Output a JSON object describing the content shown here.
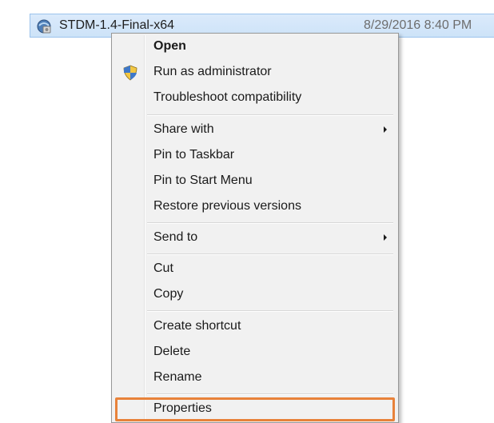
{
  "file": {
    "name": "STDM-1.4-Final-x64",
    "date": "8/29/2016 8:40 PM",
    "icon": "setup-installer-icon"
  },
  "menu": {
    "groups": [
      [
        {
          "label": "Open",
          "bold": true
        },
        {
          "label": "Run as administrator",
          "icon": "uac-shield-icon"
        },
        {
          "label": "Troubleshoot compatibility"
        }
      ],
      [
        {
          "label": "Share with",
          "submenu": true
        },
        {
          "label": "Pin to Taskbar"
        },
        {
          "label": "Pin to Start Menu"
        },
        {
          "label": "Restore previous versions"
        }
      ],
      [
        {
          "label": "Send to",
          "submenu": true
        }
      ],
      [
        {
          "label": "Cut"
        },
        {
          "label": "Copy"
        }
      ],
      [
        {
          "label": "Create shortcut"
        },
        {
          "label": "Delete"
        },
        {
          "label": "Rename"
        }
      ],
      [
        {
          "label": "Properties",
          "highlighted": true
        }
      ]
    ]
  },
  "colors": {
    "selection": "#cde3f8",
    "highlight_outline": "#e8823a",
    "menu_background": "#f1f1f1"
  }
}
